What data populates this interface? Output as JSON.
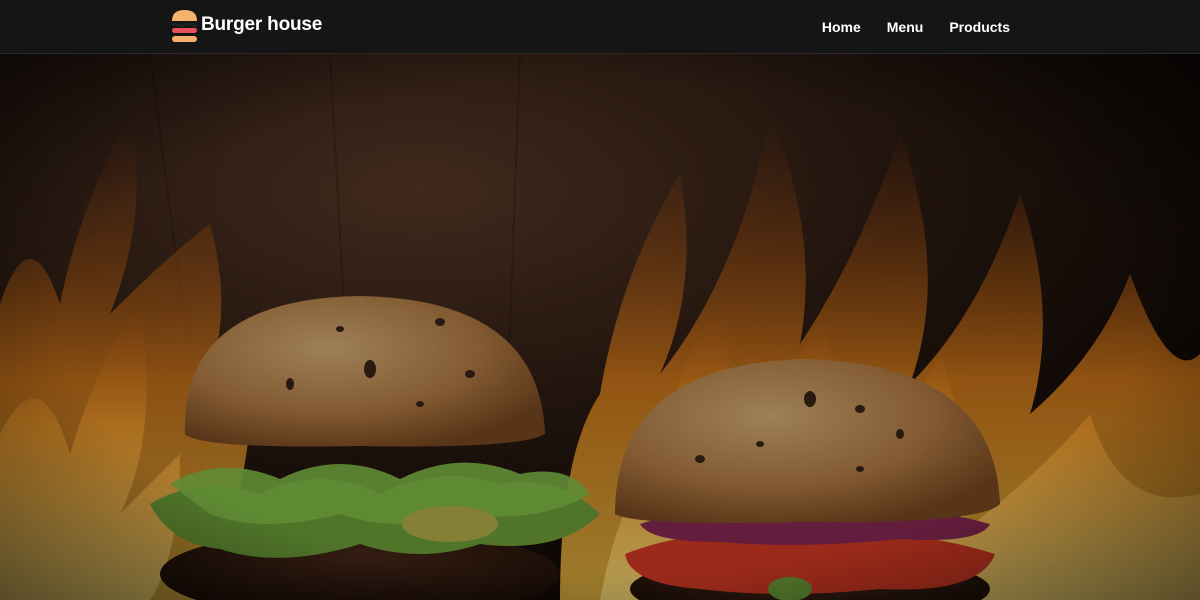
{
  "header": {
    "brand_name": "Burger house",
    "logo_icon": "burger-icon",
    "nav": [
      {
        "label": "Home"
      },
      {
        "label": "Menu"
      },
      {
        "label": "Products"
      }
    ]
  },
  "hero": {
    "image": "burgers-over-flames"
  },
  "colors": {
    "navbar_bg": "#151515",
    "nav_text": "#ffffff",
    "logo_bun": "#f6b26b",
    "logo_filling": "#e8505b"
  }
}
